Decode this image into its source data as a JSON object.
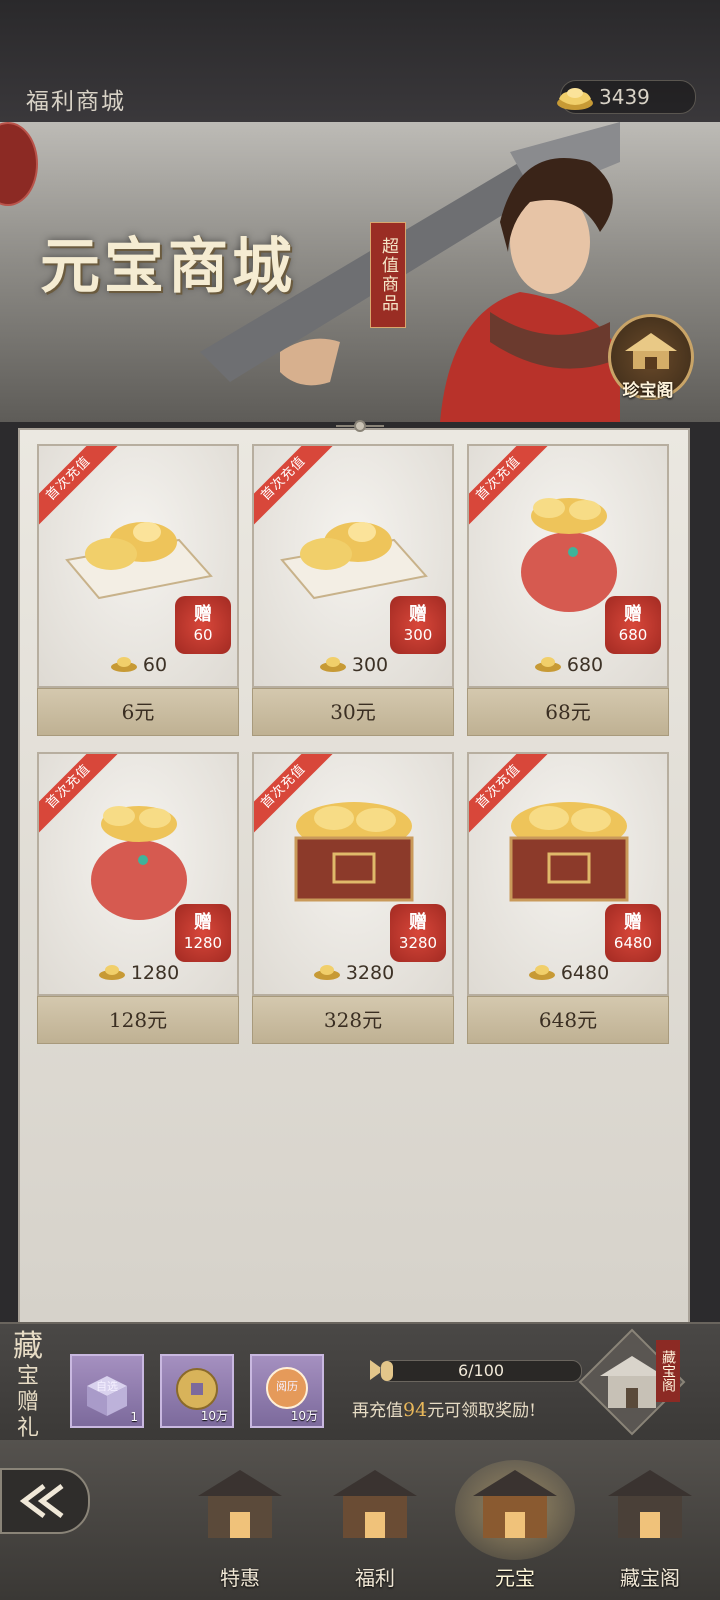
{
  "header": {
    "title": "福利商城",
    "currency": {
      "icon": "gold-ingot-icon",
      "value": "3439"
    }
  },
  "banner": {
    "title": "元宝商城",
    "tag": "超值商品",
    "treasure_button": "珍宝阁"
  },
  "products": [
    {
      "ribbon": "首次充值",
      "bonus_label": "赠",
      "bonus": "60",
      "amount": "60",
      "price": "6元",
      "art": "ingot-pile"
    },
    {
      "ribbon": "首次充值",
      "bonus_label": "赠",
      "bonus": "300",
      "amount": "300",
      "price": "30元",
      "art": "ingot-pile"
    },
    {
      "ribbon": "首次充值",
      "bonus_label": "赠",
      "bonus": "680",
      "amount": "680",
      "price": "68元",
      "art": "ingot-bag"
    },
    {
      "ribbon": "首次充值",
      "bonus_label": "赠",
      "bonus": "1280",
      "amount": "1280",
      "price": "128元",
      "art": "ingot-bag"
    },
    {
      "ribbon": "首次充值",
      "bonus_label": "赠",
      "bonus": "3280",
      "amount": "3280",
      "price": "328元",
      "art": "ingot-chest"
    },
    {
      "ribbon": "首次充值",
      "bonus_label": "赠",
      "bonus": "6480",
      "amount": "6480",
      "price": "648元",
      "art": "ingot-chest"
    }
  ],
  "gift_bar": {
    "title_big": "藏",
    "title_rest": [
      "宝",
      "赠",
      "礼"
    ],
    "items": [
      {
        "label": "自选",
        "count": "1",
        "icon": "treasure-box-icon"
      },
      {
        "label": "",
        "count": "10万",
        "icon": "copper-coin-icon"
      },
      {
        "label": "阅历",
        "count": "10万",
        "icon": "experience-orb-icon"
      }
    ],
    "progress": {
      "text": "6/100",
      "current": 6,
      "max": 100
    },
    "tip_prefix": "再充值",
    "tip_amount": "94",
    "tip_suffix": "元可领取奖励!",
    "shortcut_label": "藏宝阁"
  },
  "nav": {
    "tabs": [
      {
        "label": "特惠",
        "active": false
      },
      {
        "label": "福利",
        "active": false
      },
      {
        "label": "元宝",
        "active": true
      },
      {
        "label": "藏宝阁",
        "active": false
      }
    ]
  },
  "colors": {
    "accent_red": "#d8473a",
    "gold": "#e3c68a",
    "panel": "#ebe8e1"
  }
}
